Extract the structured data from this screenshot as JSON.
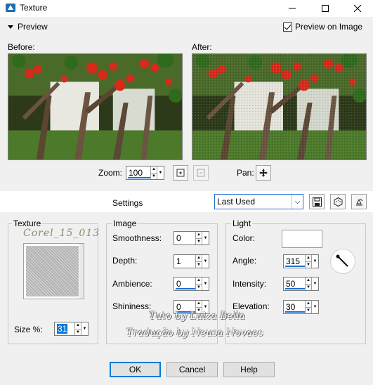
{
  "window": {
    "title": "Texture",
    "minimize_icon": "minimize-icon",
    "maximize_icon": "maximize-icon",
    "close_icon": "close-icon"
  },
  "preview": {
    "toggle_label": "Preview",
    "preview_on_image_label": "Preview on Image",
    "preview_on_image_checked": true,
    "before_label": "Before:",
    "after_label": "After:",
    "zoom_label": "Zoom:",
    "zoom_value": "100",
    "pan_label": "Pan:"
  },
  "settings": {
    "label": "Settings",
    "preset_value": "Last Used"
  },
  "texture": {
    "group_title": "Texture",
    "preset_name": "Corel_15_013",
    "size_label": "Size %:",
    "size_value": "31"
  },
  "image": {
    "group_title": "Image",
    "smoothness_label": "Smoothness:",
    "smoothness_value": "0",
    "depth_label": "Depth:",
    "depth_value": "1",
    "ambience_label": "Ambience:",
    "ambience_value": "0",
    "shininess_label": "Shininess:",
    "shininess_value": "0"
  },
  "light": {
    "group_title": "Light",
    "color_label": "Color:",
    "color_value": "#ffffff",
    "angle_label": "Angle:",
    "angle_value": "315",
    "intensity_label": "Intensity:",
    "intensity_value": "50",
    "elevation_label": "Elevation:",
    "elevation_value": "30"
  },
  "watermarks": {
    "line1": "Tuto by Luiza Bella",
    "line2": "Tradução by Neusa Novaes"
  },
  "buttons": {
    "ok": "OK",
    "cancel": "Cancel",
    "help": "Help"
  }
}
